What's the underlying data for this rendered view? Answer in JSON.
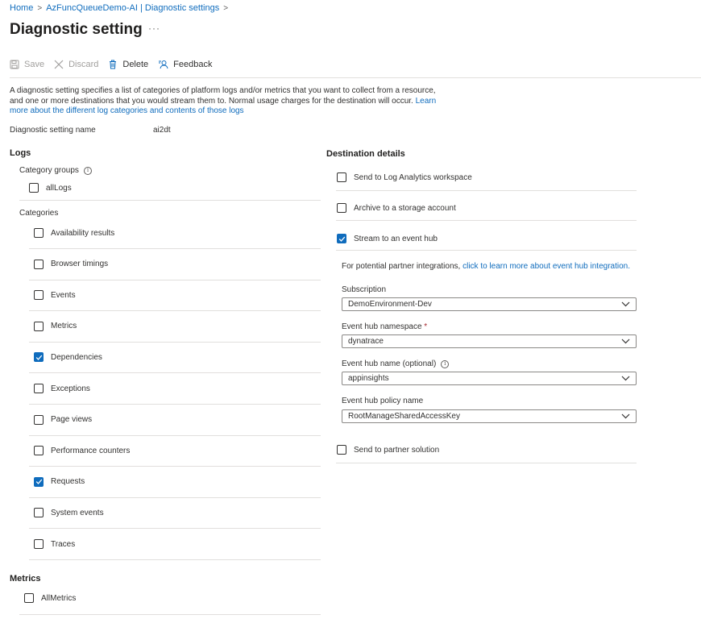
{
  "breadcrumb": [
    {
      "label": "Home"
    },
    {
      "label": "AzFuncQueueDemo-AI | Diagnostic settings"
    }
  ],
  "page_title": "Diagnostic setting",
  "more_label": "···",
  "toolbar": {
    "save": "Save",
    "discard": "Discard",
    "delete": "Delete",
    "feedback": "Feedback"
  },
  "description": {
    "text": "A diagnostic setting specifies a list of categories of platform logs and/or metrics that you want to collect from a resource, and one or more destinations that you would stream them to. Normal usage charges for the destination will occur. ",
    "link": "Learn more about the different log categories and contents of those logs"
  },
  "setting_name": {
    "label": "Diagnostic setting name",
    "value": "ai2dt"
  },
  "logs": {
    "heading": "Logs",
    "category_groups_label": "Category groups",
    "info_glyph": "i",
    "groups": [
      {
        "label": "allLogs",
        "checked": false
      }
    ],
    "categories_label": "Categories",
    "categories": [
      {
        "label": "Availability results",
        "checked": false
      },
      {
        "label": "Browser timings",
        "checked": false
      },
      {
        "label": "Events",
        "checked": false
      },
      {
        "label": "Metrics",
        "checked": false
      },
      {
        "label": "Dependencies",
        "checked": true
      },
      {
        "label": "Exceptions",
        "checked": false
      },
      {
        "label": "Page views",
        "checked": false
      },
      {
        "label": "Performance counters",
        "checked": false
      },
      {
        "label": "Requests",
        "checked": true
      },
      {
        "label": "System events",
        "checked": false
      },
      {
        "label": "Traces",
        "checked": false
      }
    ]
  },
  "metrics": {
    "heading": "Metrics",
    "items": [
      {
        "label": "AllMetrics",
        "checked": false
      }
    ]
  },
  "destination": {
    "heading": "Destination details",
    "log_analytics": {
      "label": "Send to Log Analytics workspace",
      "checked": false
    },
    "storage": {
      "label": "Archive to a storage account",
      "checked": false
    },
    "event_hub": {
      "label": "Stream to an event hub",
      "checked": true
    },
    "partner_note": {
      "text": "For potential partner integrations, ",
      "link": "click to learn more about event hub integration."
    },
    "subscription": {
      "label": "Subscription",
      "value": "DemoEnvironment-Dev"
    },
    "namespace": {
      "label": "Event hub namespace",
      "required": "*",
      "value": "dynatrace"
    },
    "hub_name": {
      "label": "Event hub name (optional)",
      "value": "appinsights"
    },
    "policy": {
      "label": "Event hub policy name",
      "value": "RootManageSharedAccessKey"
    },
    "partner": {
      "label": "Send to partner solution",
      "checked": false
    }
  },
  "colors": {
    "accent": "#0f6cbd",
    "text": "#323130",
    "divider": "#e1dfdd",
    "required": "#a4262c"
  }
}
